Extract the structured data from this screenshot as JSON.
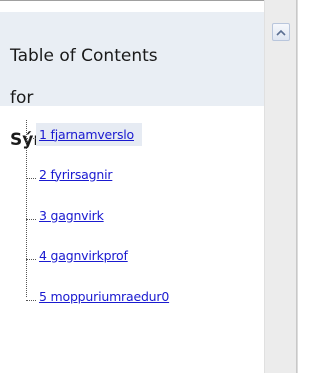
{
  "toc": {
    "title_line1": "Table of Contents",
    "title_line2": "for",
    "document_name": "Sýnishorn",
    "items": [
      {
        "label": "1 fjarnamverslo",
        "selected": true
      },
      {
        "label": "2 fyrirsagnir",
        "selected": false
      },
      {
        "label": "3 gagnvirk",
        "selected": false
      },
      {
        "label": "4 gagnvirkprof",
        "selected": false
      },
      {
        "label": "5 moppuriumraedur0",
        "selected": false
      }
    ]
  },
  "scrollbar": {
    "up_button_icon": "chevron-up-icon"
  },
  "colors": {
    "header_background": "#e9eef4",
    "link": "#1a1ad0",
    "selected_background": "#e6ebf3",
    "scrollbar_track": "#ececec"
  }
}
